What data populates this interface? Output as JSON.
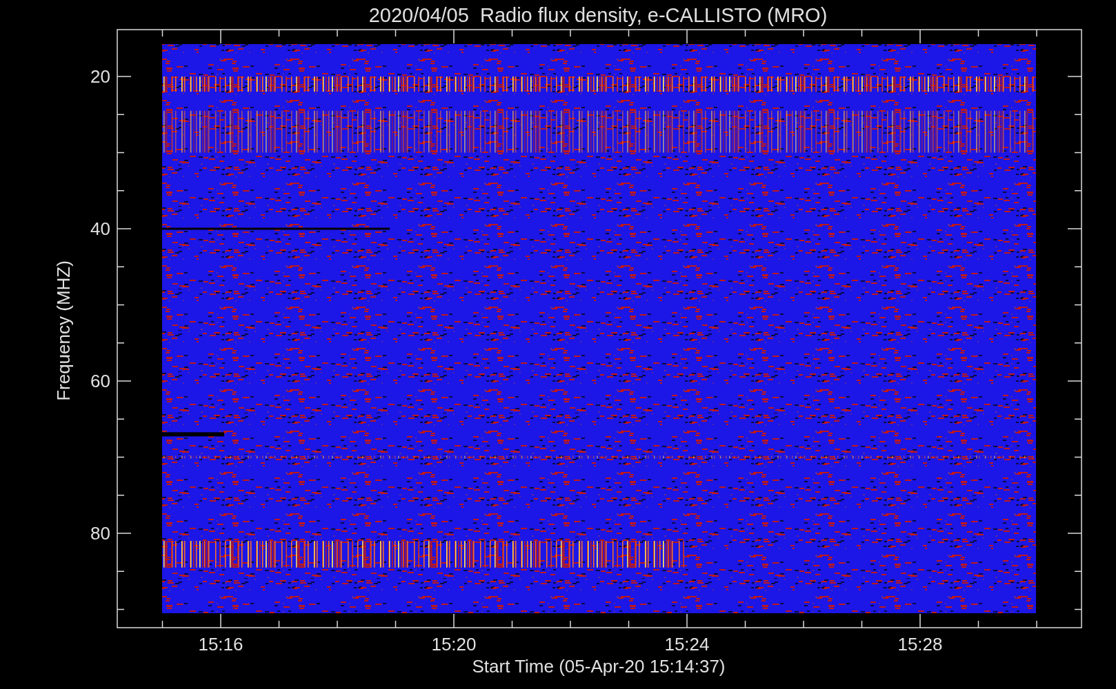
{
  "chart": {
    "title": "2020/04/05  Radio flux density, e-CALLISTO (MRO)",
    "xlabel": "Start Time (05-Apr-20 15:14:37)",
    "ylabel": "Frequency (MHZ)",
    "xticks": [
      "15:16",
      "15:20",
      "15:24",
      "15:28"
    ],
    "yticks": [
      "20",
      "40",
      "60",
      "80"
    ]
  }
}
